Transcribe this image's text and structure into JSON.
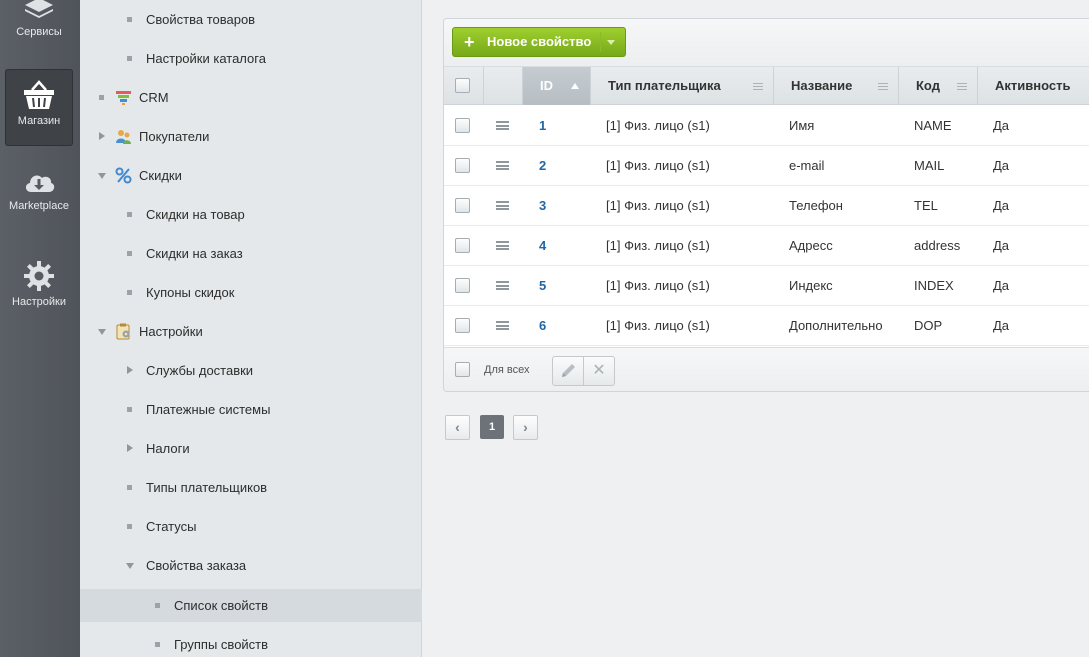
{
  "rail": {
    "items": [
      {
        "label": "Сервисы",
        "icon": "layers-icon"
      },
      {
        "label": "Магазин",
        "icon": "basket-icon",
        "active": true
      },
      {
        "label": "Marketplace",
        "icon": "cloud-download-icon"
      },
      {
        "label": "Настройки",
        "icon": "gear-icon"
      }
    ]
  },
  "menu": {
    "items": [
      {
        "label": "Свойства товаров"
      },
      {
        "label": "Настройки каталога"
      },
      {
        "label": "CRM",
        "icon": "crm-funnel-icon"
      },
      {
        "label": "Покупатели",
        "icon": "customers-icon"
      },
      {
        "label": "Скидки",
        "icon": "percent-icon"
      },
      {
        "label": "Скидки на товар"
      },
      {
        "label": "Скидки на заказ"
      },
      {
        "label": "Купоны скидок"
      },
      {
        "label": "Настройки",
        "icon": "settings-clipboard-icon"
      },
      {
        "label": "Службы доставки"
      },
      {
        "label": "Платежные системы"
      },
      {
        "label": "Налоги"
      },
      {
        "label": "Типы плательщиков"
      },
      {
        "label": "Статусы"
      },
      {
        "label": "Свойства заказа"
      },
      {
        "label": "Список свойств",
        "selected": true
      },
      {
        "label": "Группы свойств"
      }
    ]
  },
  "toolbar": {
    "new_button": "Новое свойство"
  },
  "table": {
    "columns": [
      "ID",
      "Тип плательщика",
      "Название",
      "Код",
      "Активность"
    ],
    "sorted_column": "ID",
    "sort_direction": "asc",
    "rows": [
      {
        "id": "1",
        "payer": "[1] Физ. лицо (s1)",
        "name": "Имя",
        "code": "NAME",
        "active": "Да"
      },
      {
        "id": "2",
        "payer": "[1] Физ. лицо (s1)",
        "name": "e-mail",
        "code": "MAIL",
        "active": "Да"
      },
      {
        "id": "3",
        "payer": "[1] Физ. лицо (s1)",
        "name": "Телефон",
        "code": "TEL",
        "active": "Да"
      },
      {
        "id": "4",
        "payer": "[1] Физ. лицо (s1)",
        "name": "Адресс",
        "code": "address",
        "active": "Да"
      },
      {
        "id": "5",
        "payer": "[1] Физ. лицо (s1)",
        "name": "Индекс",
        "code": "INDEX",
        "active": "Да"
      },
      {
        "id": "6",
        "payer": "[1] Физ. лицо (s1)",
        "name": "Дополнительно",
        "code": "DOP",
        "active": "Да"
      }
    ]
  },
  "footer": {
    "for_all": "Для всех"
  },
  "pager": {
    "prev": "‹",
    "current": "1",
    "next": "›"
  },
  "colors": {
    "rail_bg": "#575c62",
    "menu_bg": "#e4e8ea",
    "accent_green": "#8bbd24",
    "id_link": "#2066a5"
  }
}
